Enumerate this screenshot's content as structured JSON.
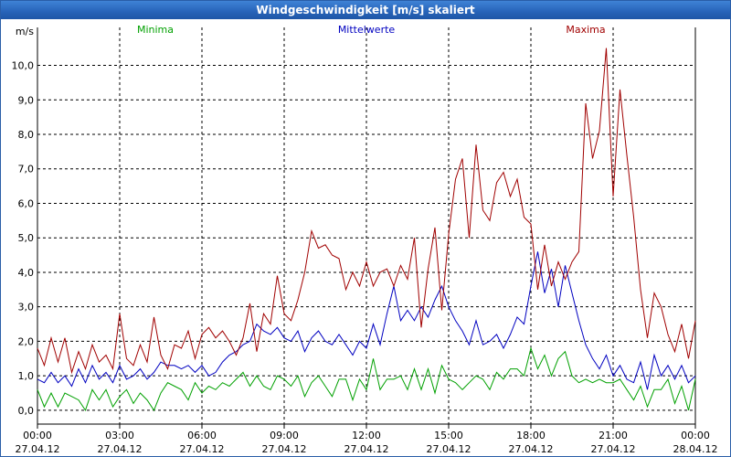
{
  "window": {
    "title": "Windgeschwindigkeit [m/s] skaliert"
  },
  "chart_data": {
    "type": "line",
    "title": "Windgeschwindigkeit [m/s] skaliert",
    "ylabel": "m/s",
    "xlabel": "",
    "ylim": [
      -0.4,
      11.1
    ],
    "grid": true,
    "legend": "top",
    "x_ticks": [
      {
        "time": "00:00",
        "date": "27.04.12"
      },
      {
        "time": "03:00",
        "date": "27.04.12"
      },
      {
        "time": "06:00",
        "date": "27.04.12"
      },
      {
        "time": "09:00",
        "date": "27.04.12"
      },
      {
        "time": "12:00",
        "date": "27.04.12"
      },
      {
        "time": "15:00",
        "date": "27.04.12"
      },
      {
        "time": "18:00",
        "date": "27.04.12"
      },
      {
        "time": "21:00",
        "date": "27.04.12"
      },
      {
        "time": "00:00",
        "date": "28.04.12"
      }
    ],
    "y_ticks": [
      "0,0",
      "1,0",
      "2,0",
      "3,0",
      "4,0",
      "5,0",
      "6,0",
      "7,0",
      "8,0",
      "9,0",
      "10,0"
    ],
    "x_hours": [
      0,
      0.25,
      0.5,
      0.75,
      1,
      1.25,
      1.5,
      1.75,
      2,
      2.25,
      2.5,
      2.75,
      3,
      3.25,
      3.5,
      3.75,
      4,
      4.25,
      4.5,
      4.75,
      5,
      5.25,
      5.5,
      5.75,
      6,
      6.25,
      6.5,
      6.75,
      7,
      7.25,
      7.5,
      7.75,
      8,
      8.25,
      8.5,
      8.75,
      9,
      9.25,
      9.5,
      9.75,
      10,
      10.25,
      10.5,
      10.75,
      11,
      11.25,
      11.5,
      11.75,
      12,
      12.25,
      12.5,
      12.75,
      13,
      13.25,
      13.5,
      13.75,
      14,
      14.25,
      14.5,
      14.75,
      15,
      15.25,
      15.5,
      15.75,
      16,
      16.25,
      16.5,
      16.75,
      17,
      17.25,
      17.5,
      17.75,
      18,
      18.25,
      18.5,
      18.75,
      19,
      19.25,
      19.5,
      19.75,
      20,
      20.25,
      20.5,
      20.75,
      21,
      21.25,
      21.5,
      21.75,
      22,
      22.25,
      22.5,
      22.75,
      23,
      23.25,
      23.5,
      23.75,
      24
    ],
    "series": [
      {
        "name": "Minima",
        "color": "#00a000",
        "values": [
          0.6,
          0.1,
          0.5,
          0.1,
          0.5,
          0.4,
          0.3,
          0.0,
          0.6,
          0.3,
          0.6,
          0.1,
          0.4,
          0.6,
          0.2,
          0.5,
          0.3,
          0.0,
          0.5,
          0.8,
          0.7,
          0.6,
          0.3,
          0.8,
          0.5,
          0.7,
          0.6,
          0.8,
          0.7,
          0.9,
          1.1,
          0.7,
          1.0,
          0.7,
          0.6,
          1.0,
          0.9,
          0.7,
          1.0,
          0.4,
          0.8,
          1.0,
          0.7,
          0.4,
          0.9,
          0.9,
          0.3,
          0.9,
          0.6,
          1.5,
          0.6,
          0.9,
          0.9,
          1.0,
          0.6,
          1.2,
          0.6,
          1.2,
          0.5,
          1.3,
          0.9,
          0.8,
          0.6,
          0.8,
          1.0,
          0.9,
          0.6,
          1.1,
          0.9,
          1.2,
          1.2,
          1.0,
          1.8,
          1.2,
          1.6,
          1.0,
          1.5,
          1.7,
          1.0,
          0.8,
          0.9,
          0.8,
          0.9,
          0.8,
          0.8,
          0.9,
          0.6,
          0.3,
          0.7,
          0.1,
          0.6,
          0.6,
          0.9,
          0.2,
          0.7,
          0.0,
          0.9
        ]
      },
      {
        "name": "Mittelwerte",
        "color": "#0000c0",
        "values": [
          0.9,
          0.8,
          1.1,
          0.8,
          1.0,
          0.7,
          1.2,
          0.8,
          1.3,
          0.9,
          1.1,
          0.8,
          1.3,
          0.9,
          1.0,
          1.2,
          0.9,
          1.1,
          1.4,
          1.3,
          1.3,
          1.2,
          1.3,
          1.1,
          1.3,
          1.0,
          1.1,
          1.4,
          1.6,
          1.7,
          1.9,
          2.0,
          2.5,
          2.3,
          2.2,
          2.4,
          2.1,
          2.0,
          2.3,
          1.7,
          2.1,
          2.3,
          2.0,
          1.9,
          2.2,
          1.9,
          1.6,
          2.0,
          1.8,
          2.5,
          1.9,
          2.8,
          3.6,
          2.6,
          2.9,
          2.6,
          3.0,
          2.7,
          3.2,
          3.6,
          3.0,
          2.6,
          2.3,
          1.9,
          2.6,
          1.9,
          2.0,
          2.2,
          1.8,
          2.2,
          2.7,
          2.5,
          3.6,
          4.6,
          3.4,
          4.1,
          3.0,
          4.2,
          3.4,
          2.6,
          1.9,
          1.5,
          1.2,
          1.6,
          1.0,
          1.3,
          0.9,
          0.8,
          1.4,
          0.6,
          1.6,
          1.0,
          1.3,
          0.9,
          1.3,
          0.8,
          1.0
        ]
      },
      {
        "name": "Maxima",
        "color": "#a00000",
        "values": [
          1.8,
          1.3,
          2.1,
          1.4,
          2.1,
          1.1,
          1.7,
          1.2,
          1.9,
          1.4,
          1.6,
          1.2,
          2.8,
          1.5,
          1.3,
          1.9,
          1.4,
          2.7,
          1.6,
          1.2,
          1.9,
          1.8,
          2.3,
          1.5,
          2.2,
          2.4,
          2.1,
          2.3,
          2.0,
          1.6,
          2.1,
          3.1,
          1.7,
          2.8,
          2.5,
          3.9,
          2.8,
          2.6,
          3.2,
          4.0,
          5.2,
          4.7,
          4.8,
          4.5,
          4.4,
          3.5,
          4.0,
          3.6,
          4.3,
          3.6,
          4.0,
          4.1,
          3.6,
          4.2,
          3.8,
          5.0,
          2.4,
          4.1,
          5.3,
          2.9,
          5.1,
          6.7,
          7.3,
          5.0,
          7.7,
          5.8,
          5.5,
          6.6,
          6.9,
          6.2,
          6.7,
          5.6,
          5.4,
          3.5,
          4.8,
          3.6,
          4.3,
          3.8,
          4.3,
          4.6,
          8.9,
          7.3,
          8.1,
          10.5,
          6.2,
          9.3,
          7.4,
          5.6,
          3.5,
          2.1,
          3.4,
          3.0,
          2.2,
          1.7,
          2.5,
          1.5,
          2.6
        ]
      }
    ]
  }
}
